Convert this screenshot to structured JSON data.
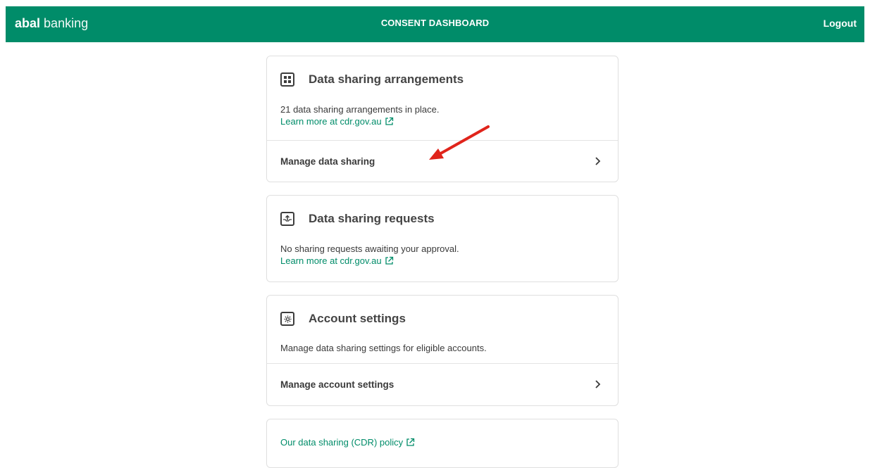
{
  "header": {
    "brand_bold": "abal",
    "brand_light": "banking",
    "title": "CONSENT DASHBOARD",
    "logout_label": "Logout"
  },
  "arrangements": {
    "title": "Data sharing arrangements",
    "description": "21 data sharing arrangements in place.",
    "learn_more": "Learn more at cdr.gov.au",
    "action_label": "Manage data sharing"
  },
  "requests": {
    "title": "Data sharing requests",
    "description": "No sharing requests awaiting your approval.",
    "learn_more": "Learn more at cdr.gov.au"
  },
  "account": {
    "title": "Account settings",
    "description": "Manage data sharing settings for eligible accounts.",
    "action_label": "Manage account settings"
  },
  "policy": {
    "link_label": "Our data sharing (CDR) policy"
  },
  "colors": {
    "brand_green": "#008c69",
    "annotation_arrow": "#e0241b"
  }
}
